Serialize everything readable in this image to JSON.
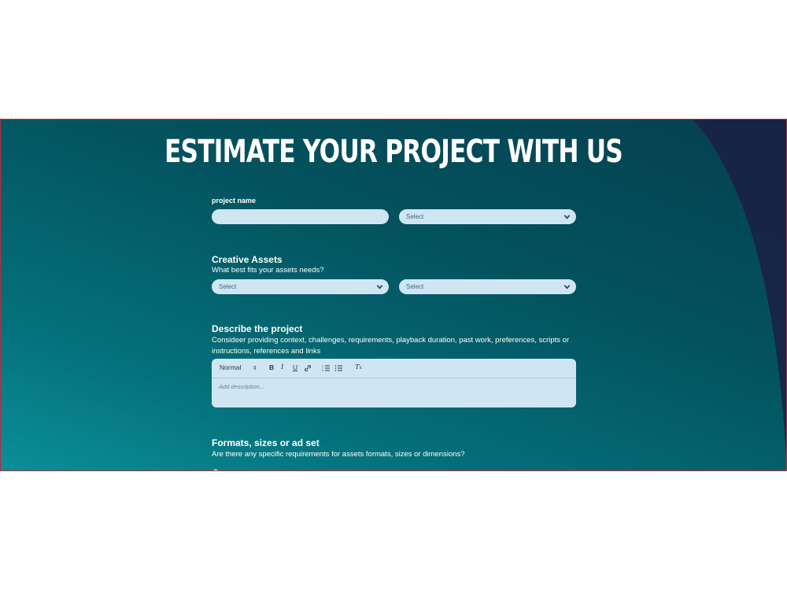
{
  "page": {
    "title": "ESTIMATE YOUR PROJECT WITH US"
  },
  "project": {
    "name_label": "project name",
    "name_value": "",
    "select_placeholder": "Select"
  },
  "creative_assets": {
    "heading": "Creative Assets",
    "question": "What best fits your assets needs?",
    "select1": "Select",
    "select2": "Select"
  },
  "describe": {
    "heading": "Describe the project",
    "help_line1": "Consideer providing context, challenges, requirements, playback duration, past work, preferences, scripts or",
    "help_line2": "instructions, references and links",
    "format_select": "Normal",
    "placeholder": "Add description..."
  },
  "formats": {
    "heading": "Formats, sizes or ad set",
    "question": "Are there any specific requirements for assets formats, sizes or dimensions?"
  },
  "colors": {
    "bg_top": "#063f4f",
    "bg_bottom": "#0a8f99",
    "field_bg": "#cfe6f2",
    "corner": "#1b1f45"
  },
  "icons": [
    "chevron-down-icon",
    "bold-icon",
    "italic-icon",
    "underline-icon",
    "link-icon",
    "ordered-list-icon",
    "bullet-list-icon",
    "clear-format-icon"
  ]
}
